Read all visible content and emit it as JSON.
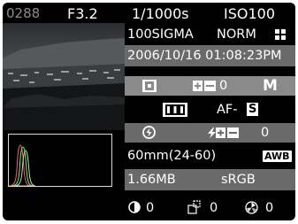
{
  "top_bar": {
    "file_number": "0288",
    "aperture": "F3.2",
    "shutter_speed": "1/1000s",
    "iso": "ISO100"
  },
  "info": {
    "folder": "100SIGMA",
    "quality": "NORM",
    "datetime": "2006/10/16 01:08:23PM",
    "exposure_comp": "0",
    "mode": "M",
    "focus_mode": "AF-",
    "focus_mode_badge": "S",
    "flash_comp": "0",
    "focal_length": "60mm(24-60)",
    "white_balance": "AWB",
    "file_size": "1.66MB",
    "color_space": "sRGB",
    "contrast": "0",
    "sharpness": "0",
    "saturation": "0"
  },
  "icons": [
    "quality-grid-icon",
    "metering-icon",
    "exposure-comp-icon",
    "af-area-icon",
    "flash-off-icon",
    "flash-comp-icon",
    "contrast-icon",
    "sharpness-icon",
    "saturation-icon"
  ],
  "colors": {
    "background": "#000000",
    "text": "#ffffff",
    "band_dark": "#6a6a6a",
    "band_light": "#8a8a8a",
    "file_number": "#8c8c8c"
  }
}
